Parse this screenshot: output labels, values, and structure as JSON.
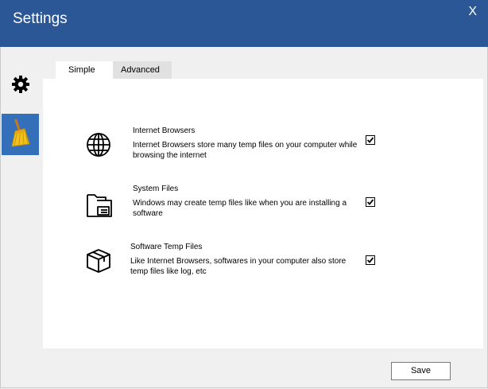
{
  "window": {
    "title": "Settings",
    "close_label": "X"
  },
  "sidebar": {
    "items": [
      {
        "icon": "gear-icon",
        "selected": false
      },
      {
        "icon": "broom-icon",
        "selected": true
      }
    ],
    "accent": "#3470b9"
  },
  "tabs": [
    {
      "label": "Simple",
      "active": true
    },
    {
      "label": "Advanced",
      "active": false
    }
  ],
  "options": [
    {
      "icon": "globe-icon",
      "title": "Internet Browsers",
      "description": "Internet Browsers store many temp files on your computer while browsing the internet",
      "checked": true
    },
    {
      "icon": "folder-icon",
      "title": "System Files",
      "description": "Windows may create temp files like when you are installing a software",
      "checked": true
    },
    {
      "icon": "box-icon",
      "title": "Software Temp Files",
      "description": "Like Internet Browsers, softwares in your computer also store temp files like log, etc",
      "checked": true
    }
  ],
  "footer": {
    "save_label": "Save"
  },
  "colors": {
    "titlebar": "#2b5797",
    "panel": "#ffffff",
    "background": "#f0f0f0"
  }
}
